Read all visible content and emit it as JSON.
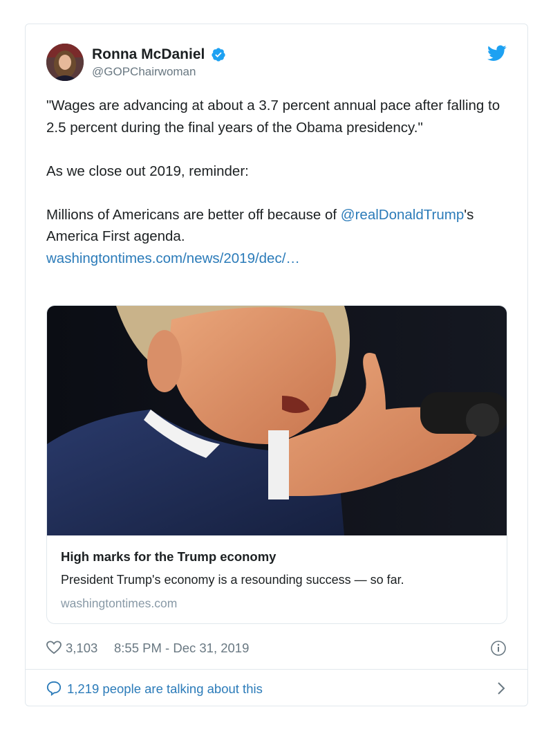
{
  "tweet": {
    "author": {
      "display_name": "Ronna McDaniel",
      "handle": "@GOPChairwoman",
      "verified": true
    },
    "text": {
      "line1": "\"Wages are advancing at about a 3.7 percent annual pace after falling to 2.5 percent during the final years of the Obama presidency.\"",
      "line2": "As we close out 2019, reminder:",
      "line3_prefix": "Millions of Americans are better off because of ",
      "mention": "@realDonaldTrump",
      "line3_suffix": "'s America First agenda.",
      "url": "washingtontimes.com/news/2019/dec/…"
    },
    "card": {
      "title": "High marks for the Trump economy",
      "description": "President Trump's economy is a resounding success — so far.",
      "domain": "washingtontimes.com"
    },
    "meta": {
      "likes": "3,103",
      "timestamp": "8:55 PM - Dec 31, 2019"
    },
    "footer": {
      "talking": "1,219 people are talking about this"
    }
  },
  "colors": {
    "link": "#2b7bb9",
    "twitter_blue": "#1da1f2",
    "muted": "#697882",
    "border": "#e1e8ed"
  },
  "icons": [
    "verified-badge-icon",
    "twitter-bird-icon",
    "heart-icon",
    "info-icon",
    "speech-bubble-icon",
    "chevron-right-icon"
  ]
}
